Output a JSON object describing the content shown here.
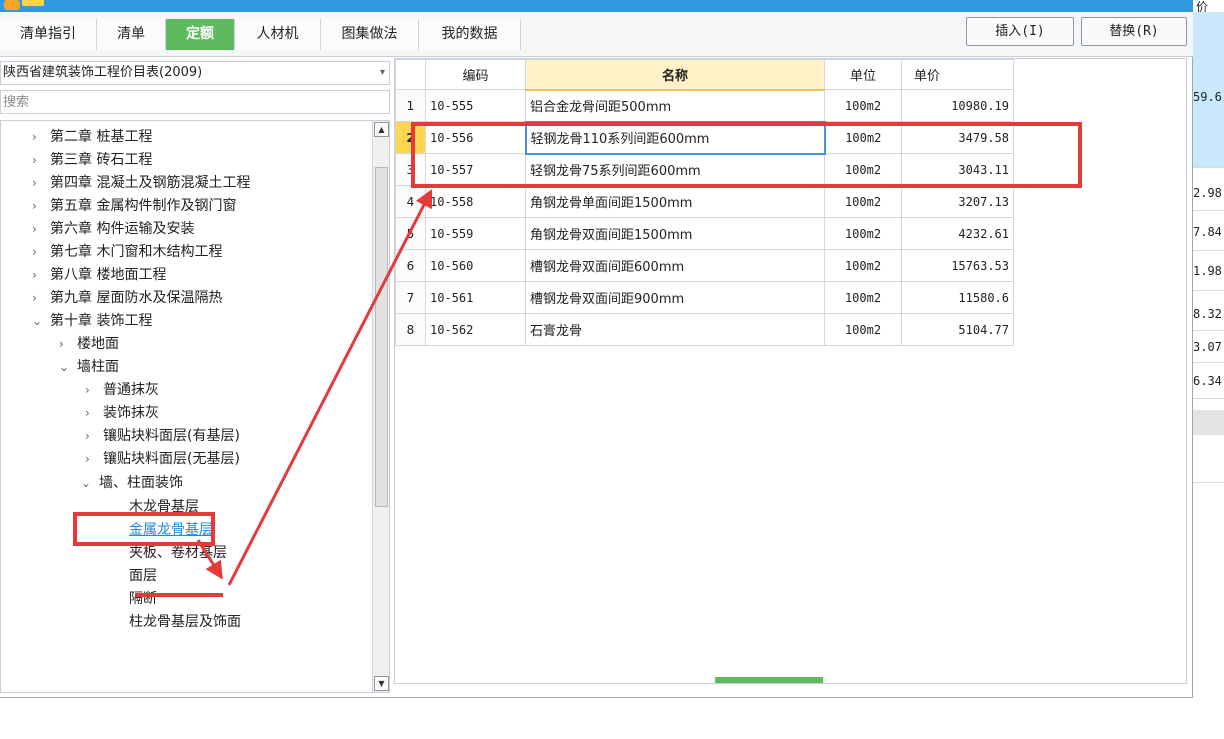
{
  "window": {
    "header_right": "价"
  },
  "tabs": [
    {
      "label": "清单指引",
      "active": false
    },
    {
      "label": "清单",
      "active": false
    },
    {
      "label": "定额",
      "active": true
    },
    {
      "label": "人材机",
      "active": false
    },
    {
      "label": "图集做法",
      "active": false
    },
    {
      "label": "我的数据",
      "active": false
    }
  ],
  "toolbar": {
    "insert_label": "插入(I)",
    "replace_label": "替换(R)"
  },
  "library": {
    "selected": "陕西省建筑装饰工程价目表(2009)",
    "search_placeholder": "搜索"
  },
  "tree": [
    {
      "label": "第二章  桩基工程",
      "chevron": "›"
    },
    {
      "label": "第三章  砖石工程",
      "chevron": "›"
    },
    {
      "label": "第四章  混凝土及钢筋混凝土工程",
      "chevron": "›"
    },
    {
      "label": "第五章  金属构件制作及钢门窗",
      "chevron": "›"
    },
    {
      "label": "第六章  构件运输及安装",
      "chevron": "›"
    },
    {
      "label": "第七章  木门窗和木结构工程",
      "chevron": "›"
    },
    {
      "label": "第八章  楼地面工程",
      "chevron": "›"
    },
    {
      "label": "第九章  屋面防水及保温隔热",
      "chevron": "›"
    },
    {
      "label": "第十章  装饰工程",
      "chevron": "⌄"
    },
    {
      "label": "楼地面",
      "chevron": "›"
    },
    {
      "label": "墙柱面",
      "chevron": "⌄"
    },
    {
      "label": "普通抹灰",
      "chevron": "›"
    },
    {
      "label": "装饰抹灰",
      "chevron": "›"
    },
    {
      "label": "镶贴块料面层(有基层)",
      "chevron": "›"
    },
    {
      "label": "镶贴块料面层(无基层)",
      "chevron": "›"
    },
    {
      "label": "墙、柱面装饰",
      "chevron": "⌄"
    },
    {
      "label": "木龙骨基层",
      "chevron": ""
    },
    {
      "label": "金属龙骨基层",
      "chevron": ""
    },
    {
      "label": "夹板、卷材基层",
      "chevron": ""
    },
    {
      "label": "面层",
      "chevron": ""
    },
    {
      "label": "隔断",
      "chevron": ""
    },
    {
      "label": "柱龙骨基层及饰面",
      "chevron": ""
    }
  ],
  "grid": {
    "headers": {
      "code": "编码",
      "name": "名称",
      "unit": "单位",
      "price": "单价"
    },
    "rows": [
      {
        "n": "1",
        "code": "10-555",
        "name": "铝合金龙骨间距500mm",
        "unit": "100m2",
        "price": "10980.19"
      },
      {
        "n": "2",
        "code": "10-556",
        "name": "轻钢龙骨110系列间距600mm",
        "unit": "100m2",
        "price": "3479.58"
      },
      {
        "n": "3",
        "code": "10-557",
        "name": "轻钢龙骨75系列间距600mm",
        "unit": "100m2",
        "price": "3043.11"
      },
      {
        "n": "4",
        "code": "10-558",
        "name": "角钢龙骨单面间距1500mm",
        "unit": "100m2",
        "price": "3207.13"
      },
      {
        "n": "5",
        "code": "10-559",
        "name": "角钢龙骨双面间距1500mm",
        "unit": "100m2",
        "price": "4232.61"
      },
      {
        "n": "6",
        "code": "10-560",
        "name": "槽钢龙骨双面间距600mm",
        "unit": "100m2",
        "price": "15763.53"
      },
      {
        "n": "7",
        "code": "10-561",
        "name": "槽钢龙骨双面间距900mm",
        "unit": "100m2",
        "price": "11580.6"
      },
      {
        "n": "8",
        "code": "10-562",
        "name": "石膏龙骨",
        "unit": "100m2",
        "price": "5104.77"
      }
    ]
  },
  "right_strip": [
    "59.6",
    "2.98",
    "7.84",
    "1.98",
    "8.32",
    "3.07",
    "6.34"
  ],
  "colors": {
    "accent_green": "#5fba5f",
    "highlight_red": "#e5393a",
    "link_blue": "#1c8be0",
    "header_gold": "#fff2c8"
  }
}
